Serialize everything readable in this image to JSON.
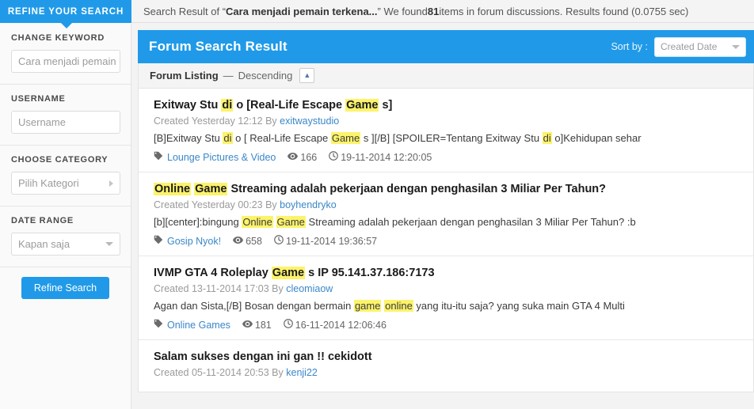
{
  "topbar": {
    "refine_tab": "REFINE YOUR SEARCH",
    "summary_prefix": "Search Result of “",
    "summary_query": "Cara menjadi pemain terkena...",
    "summary_mid": "” We found ",
    "summary_count": "81",
    "summary_suffix": " items in forum discussions. Results found (0.0755 sec)"
  },
  "sidebar": {
    "keyword": {
      "label": "CHANGE KEYWORD",
      "value": "Cara menjadi pemain",
      "placeholder": "Cara menjadi pemain"
    },
    "username": {
      "label": "USERNAME",
      "value": "",
      "placeholder": "Username"
    },
    "category": {
      "label": "CHOOSE CATEGORY",
      "value": "Pilih Kategori",
      "icon": "chevron-right-icon"
    },
    "date_range": {
      "label": "DATE RANGE",
      "value": "Kapan saja",
      "icon": "chevron-down-icon"
    },
    "refine_button": "Refine Search"
  },
  "panel": {
    "title": "Forum Search Result",
    "sort_label": "Sort by :",
    "sort_value": "Created Date",
    "listing_label": "Forum Listing",
    "listing_dash": "—",
    "listing_order": "Descending",
    "order_toggle_icon": "caret-up-icon"
  },
  "results": [
    {
      "title_parts": [
        {
          "t": "Exitway Stu ",
          "h": false
        },
        {
          "t": "di",
          "h": true
        },
        {
          "t": " o [Real-Life Escape ",
          "h": false
        },
        {
          "t": "Game",
          "h": true
        },
        {
          "t": " s]",
          "h": false
        }
      ],
      "meta_created": "Created Yesterday 12:12 By ",
      "meta_author": "exitwaystudio",
      "snippet_parts": [
        {
          "t": "[B]Exitway Stu ",
          "h": false
        },
        {
          "t": "di",
          "h": true
        },
        {
          "t": " o [ Real-Life Escape ",
          "h": false
        },
        {
          "t": "Game",
          "h": true
        },
        {
          "t": " s ][/B] [SPOILER=Tentang Exitway Stu ",
          "h": false
        },
        {
          "t": "di",
          "h": true
        },
        {
          "t": " o]Kehidupan sehar",
          "h": false
        }
      ],
      "category": "Lounge Pictures & Video",
      "views": "166",
      "date": "19-11-2014 12:20:05"
    },
    {
      "title_parts": [
        {
          "t": "Online",
          "h": true
        },
        {
          "t": " ",
          "h": false
        },
        {
          "t": "Game",
          "h": true
        },
        {
          "t": " Streaming adalah pekerjaan dengan penghasilan 3 Miliar Per Tahun?",
          "h": false
        }
      ],
      "meta_created": "Created Yesterday 00:23 By ",
      "meta_author": "boyhendryko",
      "snippet_parts": [
        {
          "t": "[b][center]:bingung ",
          "h": false
        },
        {
          "t": "Online",
          "h": true
        },
        {
          "t": " ",
          "h": false
        },
        {
          "t": "Game",
          "h": true
        },
        {
          "t": " Streaming adalah pekerjaan dengan penghasilan 3 Miliar Per Tahun? :b",
          "h": false
        }
      ],
      "category": "Gosip Nyok!",
      "views": "658",
      "date": "19-11-2014 19:36:57"
    },
    {
      "title_parts": [
        {
          "t": "IVMP GTA 4 Roleplay ",
          "h": false
        },
        {
          "t": "Game",
          "h": true
        },
        {
          "t": " s IP 95.141.37.186:7173",
          "h": false
        }
      ],
      "meta_created": "Created 13-11-2014 17:03 By ",
      "meta_author": "cleomiaow",
      "snippet_parts": [
        {
          "t": "Agan dan Sista,[/B] Bosan dengan bermain ",
          "h": false
        },
        {
          "t": "game",
          "h": true
        },
        {
          "t": " ",
          "h": false
        },
        {
          "t": "online",
          "h": true
        },
        {
          "t": " yang itu-itu saja? yang suka main GTA 4 Multi",
          "h": false
        }
      ],
      "category": "Online Games",
      "views": "181",
      "date": "16-11-2014 12:06:46"
    },
    {
      "title_parts": [
        {
          "t": "Salam sukses dengan ini gan !! cekidott",
          "h": false
        }
      ],
      "meta_created": "Created 05-11-2014 20:53 By ",
      "meta_author": "kenji22",
      "snippet_parts": [],
      "category": "",
      "views": "",
      "date": ""
    }
  ],
  "icons": {
    "tag": "tag-icon",
    "eye": "eye-icon",
    "clock": "clock-icon"
  },
  "colors": {
    "accent": "#209ae8",
    "highlight": "#fcf36b",
    "link": "#3a87c8"
  }
}
